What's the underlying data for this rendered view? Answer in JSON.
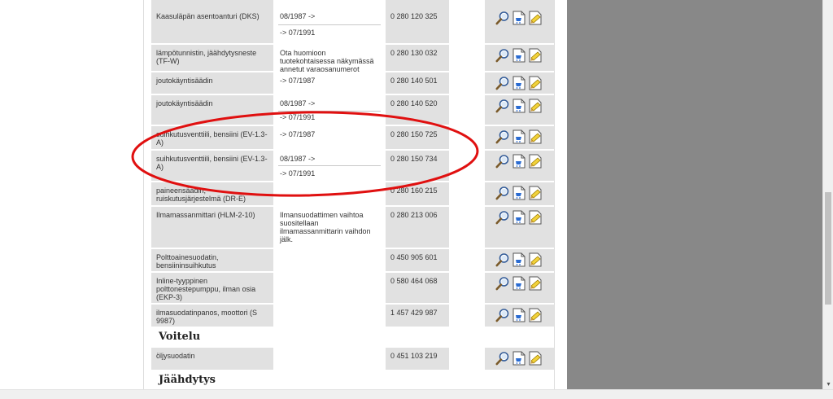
{
  "rows": [
    {
      "name": "Kaasuläpän asentoanturi (DKS)",
      "time": [
        "08/1987 ->",
        "-> 07/1991"
      ],
      "part": "0 280 120 325"
    },
    {
      "name": "lämpötunnistin, jäähdytysneste (TF-W)",
      "note": "Ota huomioon tuotekohtaisessa näkymässä annetut varaosanumerot",
      "part": "0 280 130 032"
    },
    {
      "name": "joutokäyntisäädin",
      "time": [
        "-> 07/1987"
      ],
      "part": "0 280 140 501"
    },
    {
      "name": "joutokäyntisäädin",
      "time": [
        "08/1987 ->",
        "-> 07/1991"
      ],
      "part": "0 280 140 520"
    },
    {
      "name": "suihkutusventtiili, bensiini (EV-1.3-A)",
      "time": [
        "-> 07/1987"
      ],
      "part": "0 280 150 725"
    },
    {
      "name": "suihkutusventtiili, bensiini (EV-1.3-A)",
      "time": [
        "08/1987 ->",
        "-> 07/1991"
      ],
      "part": "0 280 150 734"
    },
    {
      "name": "paineensäädin, ruiskutusjärjestelmä (DR-E)",
      "part": "0 280 160 215"
    },
    {
      "name": "Ilmamassanmittari (HLM-2-10)",
      "note": "Ilmansuodattimen vaihtoa suositellaan ilmamassanmittarin vaihdon jälk.",
      "part": "0 280 213 006"
    },
    {
      "name": "Polttoainesuodatin, bensiininsuihkutus",
      "part": "0 450 905 601"
    },
    {
      "name": "Inline-tyyppinen polttonestepumppu, ilman osia (EKP-3)",
      "part": "0 580 464 068"
    },
    {
      "name": "ilmasuodatinpanos, moottori (S 9987)",
      "part": "1 457 429 987"
    },
    {
      "name": "öljysuodatin",
      "part": "0 451 103 219"
    }
  ],
  "sections": {
    "lubrication": "Voitelu",
    "cooling": "Jäähdytys"
  },
  "icons": [
    "magnifier-icon",
    "shopping-cart-icon",
    "notepad-icon"
  ],
  "colors": {
    "annotation": "#e01010",
    "panel": "#888888",
    "cell_gray": "#e1e1e1"
  }
}
